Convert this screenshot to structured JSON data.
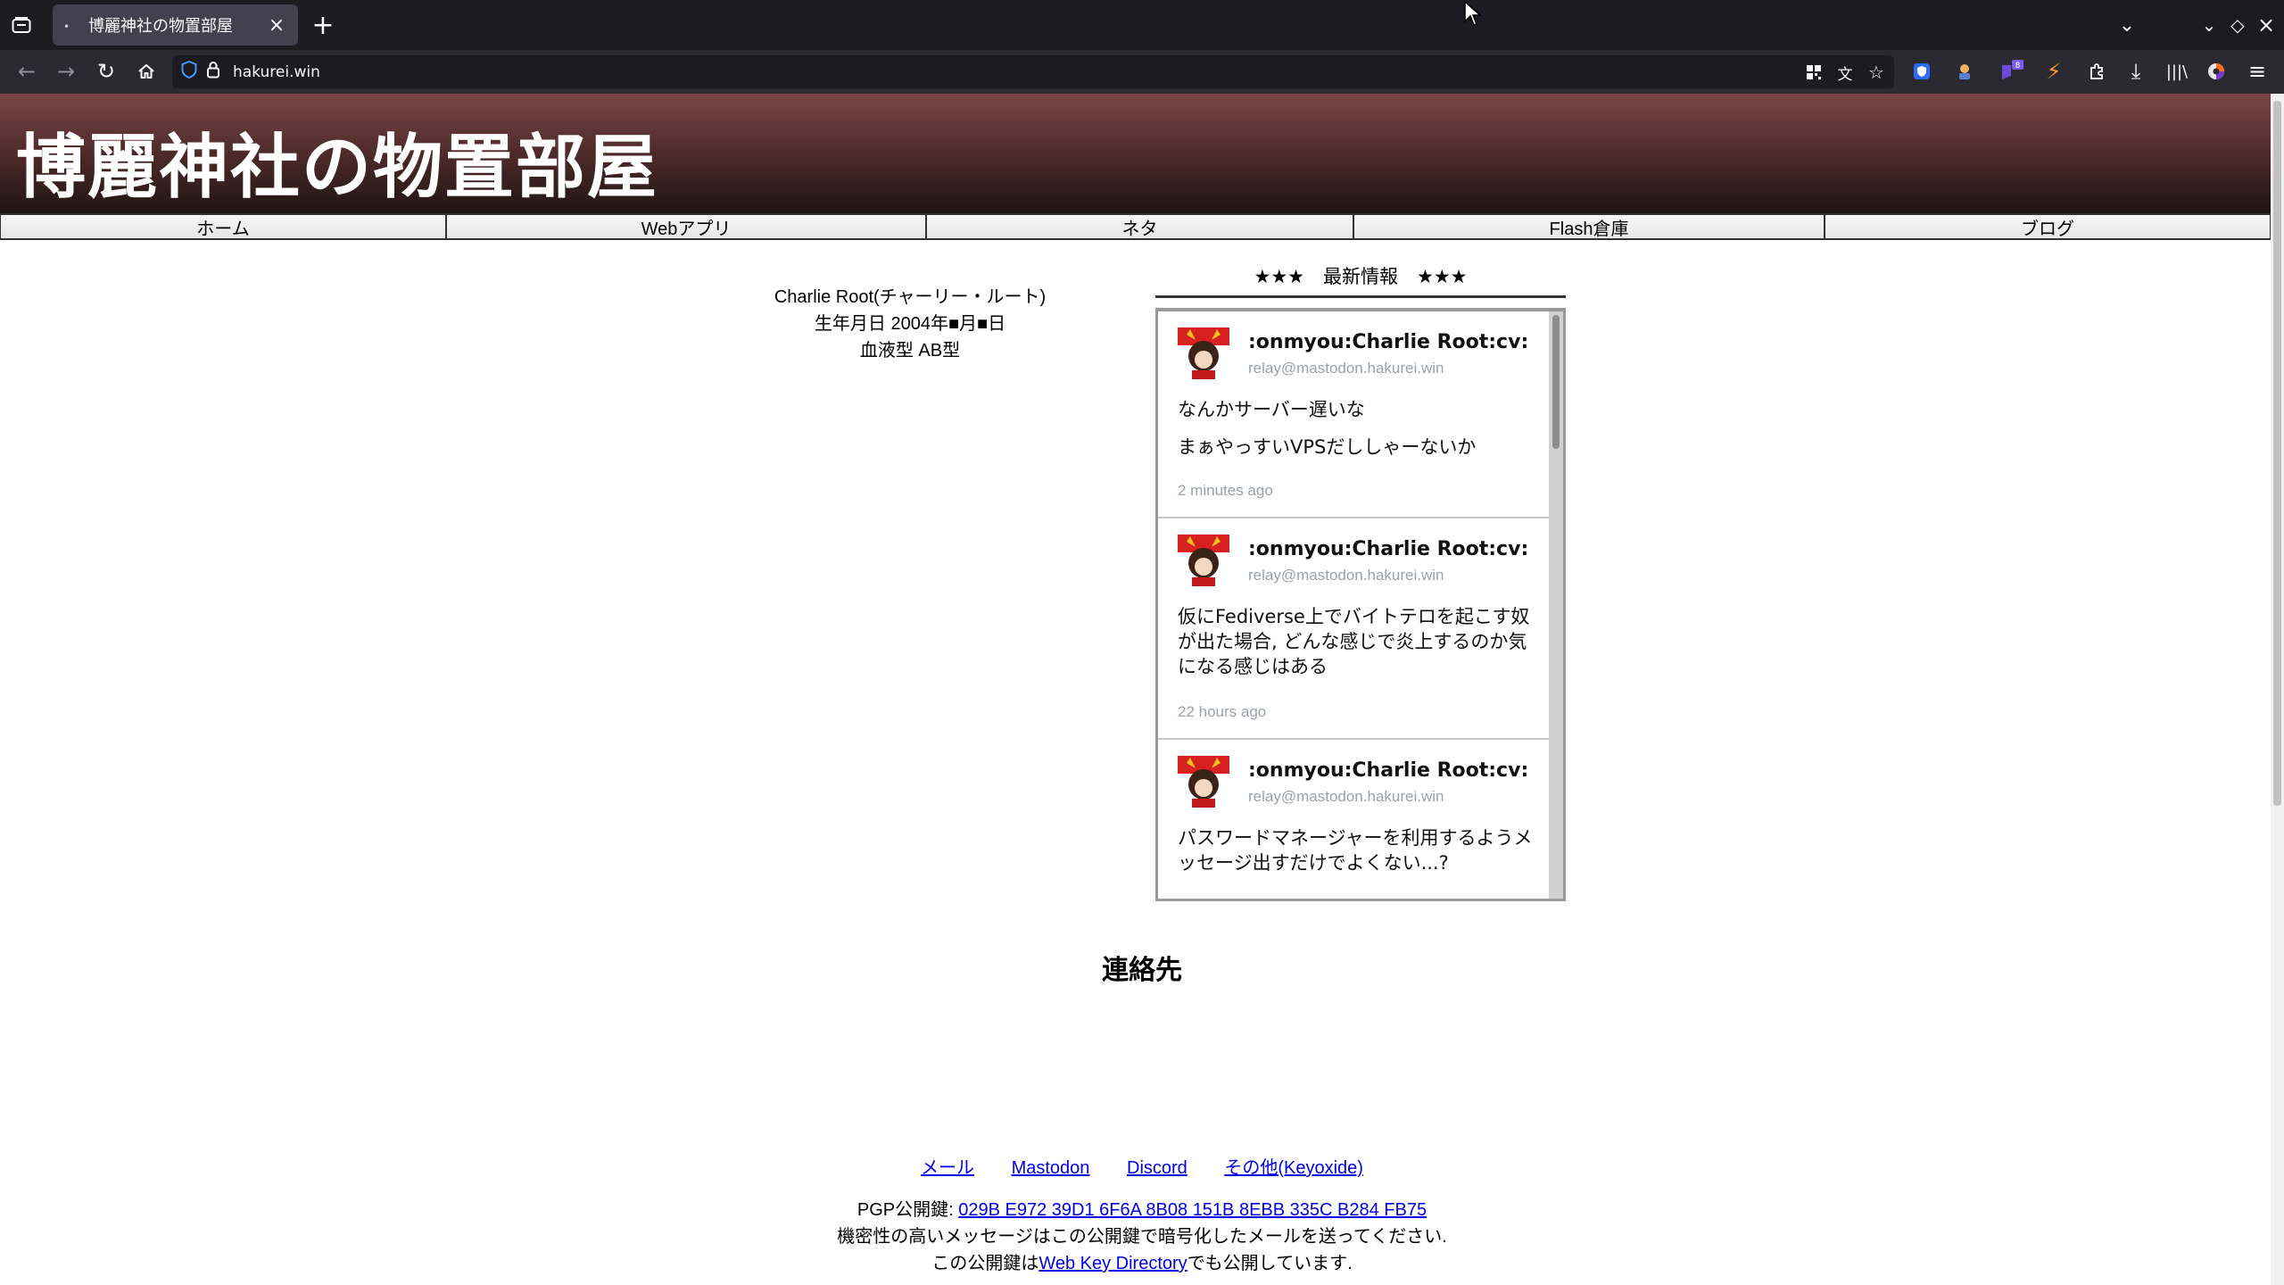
{
  "browser": {
    "tab_title": "博麗神社の物置部屋",
    "url": "hakurei.win",
    "extension_badge": "8"
  },
  "site": {
    "title": "博麗神社の物置部屋",
    "nav": [
      {
        "label": "ホーム"
      },
      {
        "label": "Webアプリ"
      },
      {
        "label": "ネタ"
      },
      {
        "label": "Flash倉庫"
      },
      {
        "label": "ブログ"
      }
    ]
  },
  "profile": {
    "name": "Charlie Root(チャーリー・ルート)",
    "birthday": "生年月日 2004年■月■日",
    "blood_type": "血液型 AB型"
  },
  "news": {
    "header": "★★★　最新情報　★★★",
    "posts": [
      {
        "display_name": ":onmyou:Charlie Root:cv:",
        "handle": "relay@mastodon.hakurei.win",
        "lines": [
          "なんかサーバー遅いな",
          "まぁやっすいVPSだししゃーないか"
        ],
        "time": "2 minutes ago"
      },
      {
        "display_name": ":onmyou:Charlie Root:cv:",
        "handle": "relay@mastodon.hakurei.win",
        "lines": [
          "仮にFediverse上でバイトテロを起こす奴が出た場合, どんな感じで炎上するのか気になる感じはある"
        ],
        "time": "22 hours ago"
      },
      {
        "display_name": ":onmyou:Charlie Root:cv:",
        "handle": "relay@mastodon.hakurei.win",
        "lines": [
          "パスワードマネージャーを利用するようメッセージ出すだけでよくない...?"
        ],
        "time": ""
      }
    ]
  },
  "contact": {
    "title": "連絡先",
    "links": [
      {
        "label": "メール"
      },
      {
        "label": "Mastodon"
      },
      {
        "label": "Discord"
      },
      {
        "label": "その他(Keyoxide)"
      }
    ],
    "pgp_prefix": "PGP公開鍵: ",
    "pgp_fingerprint": "029B E972 39D1 6F6A 8B08 151B 8EBB 335C B284 FB75",
    "pgp_note": "機密性の高いメッセージはこの公開鍵で暗号化したメールを送ってください.",
    "wkd_prefix": "この公開鍵は",
    "wkd_link": "Web Key Directory",
    "wkd_suffix": "でも公開しています."
  }
}
